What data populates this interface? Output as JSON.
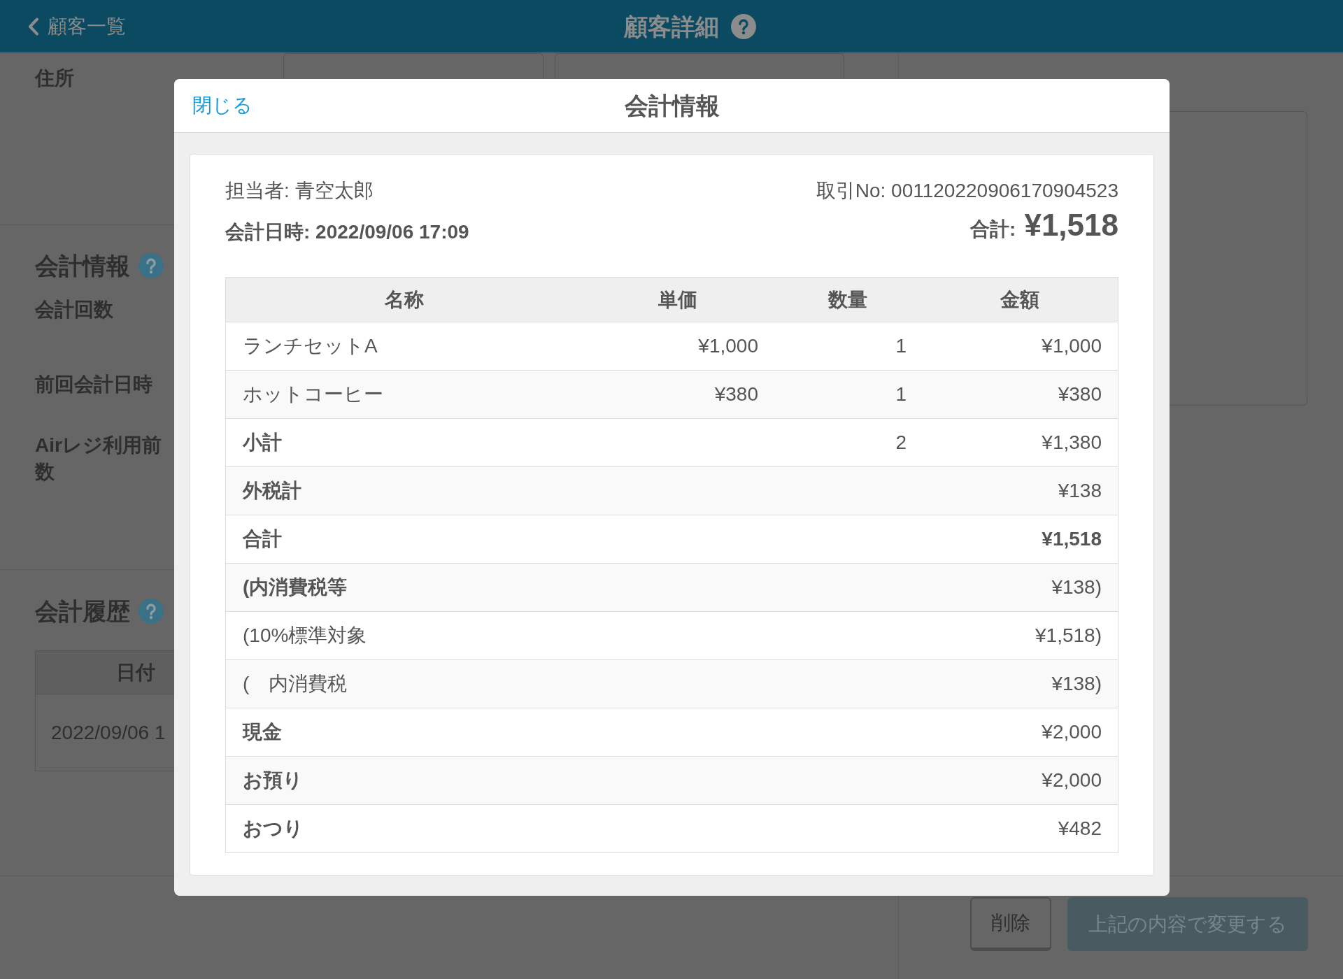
{
  "header": {
    "back_link": "顧客一覧",
    "title": "顧客詳細"
  },
  "address": {
    "label": "住所"
  },
  "checkout_section": {
    "title": "会計情報",
    "labels": [
      "会計回数",
      "前回会計日時",
      "Airレジ利用前数"
    ]
  },
  "history_section": {
    "title": "会計履歴",
    "columns": [
      "日付"
    ],
    "rows": [
      [
        "2022/09/06 1"
      ]
    ]
  },
  "buttons": [
    {
      "label": "削除",
      "kind": "secondary",
      "disabled": false
    },
    {
      "label": "上記の内容で変更する",
      "kind": "primary",
      "disabled": true
    }
  ],
  "dialog": {
    "close_link": "閉じる",
    "title": "会計情報",
    "staff": "担当者: 青空太郎",
    "transaction_no": "取引No: 001120220906170904523",
    "checkout_time": "会計日時: 2022/09/06 17:09",
    "total_label": "合計:",
    "total_amount": "¥1,518",
    "table": {
      "columns": [
        "名称",
        "単価",
        "数量",
        "金額"
      ],
      "rows": [
        {
          "name": "ランチセットA",
          "unit_price": "¥1,000",
          "quantity": "1",
          "amount": "¥1,000",
          "label_bold": false,
          "amount_bold": false
        },
        {
          "name": "ホットコーヒー",
          "unit_price": "¥380",
          "quantity": "1",
          "amount": "¥380",
          "label_bold": false,
          "amount_bold": false
        },
        {
          "name": "小計",
          "quantity": "2",
          "amount": "¥1,380",
          "label_bold": true,
          "amount_bold": false
        },
        {
          "name": "外税計",
          "amount": "¥138",
          "label_bold": true,
          "amount_bold": false
        },
        {
          "name": "合計",
          "amount": "¥1,518",
          "label_bold": true,
          "amount_bold": true
        },
        {
          "name": "(内消費税等",
          "amount": "¥138)",
          "label_bold": true,
          "amount_bold": false
        },
        {
          "name": "(10%標準対象",
          "amount": "¥1,518)",
          "label_bold": false,
          "amount_bold": false
        },
        {
          "name": "(　内消費税",
          "amount": "¥138)",
          "label_bold": false,
          "amount_bold": false
        },
        {
          "name": "現金",
          "amount": "¥2,000",
          "label_bold": true,
          "amount_bold": false
        },
        {
          "name": "お預り",
          "amount": "¥2,000",
          "label_bold": true,
          "amount_bold": false
        },
        {
          "name": "おつり",
          "amount": "¥482",
          "label_bold": true,
          "amount_bold": false
        }
      ]
    }
  }
}
